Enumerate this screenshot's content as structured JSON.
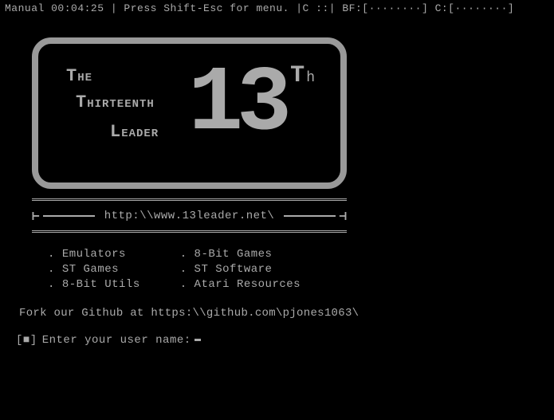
{
  "status": {
    "text": "Manual 00:04:25 | Press Shift-Esc for menu. |C   ::| BF:[········] C:[········]"
  },
  "logo": {
    "line1_cap": "T",
    "line1_rest": "HE",
    "line2_cap": "T",
    "line2_rest": "HIRTEENTH",
    "line3_cap": "L",
    "line3_rest": "EADER",
    "number": "13",
    "suffix_big": "T",
    "suffix_small": "h"
  },
  "url": "http:\\\\www.13leader.net\\",
  "menu": {
    "col1": [
      "Emulators",
      "ST Games",
      "8-Bit Utils"
    ],
    "col2": [
      "8-Bit Games",
      "ST Software",
      "Atari Resources"
    ]
  },
  "github": "Fork our Github at https:\\\\github.com\\pjones1063\\",
  "prompt": {
    "icon": "[■]",
    "text": "Enter your user name:"
  }
}
